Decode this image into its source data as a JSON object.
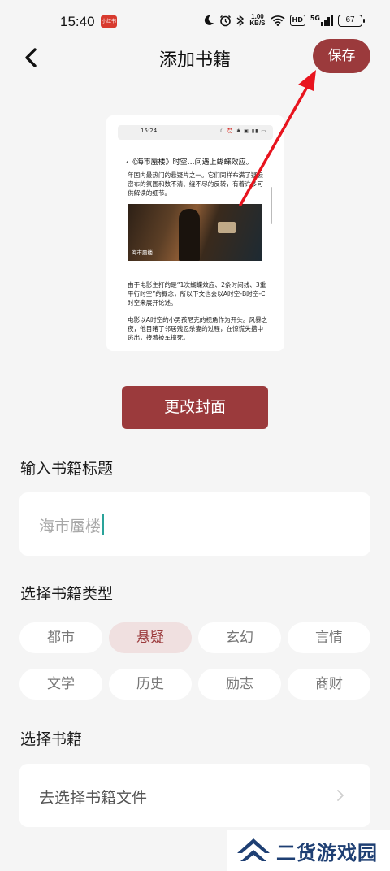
{
  "status_bar": {
    "time": "15:40",
    "app_icon_text": "小红书",
    "net_speed_value": "1.00",
    "net_speed_unit": "KB/S",
    "hd_label": "HD",
    "signal_label": "5G",
    "battery": "67"
  },
  "header": {
    "title": "添加书籍",
    "save_label": "保存"
  },
  "cover": {
    "mini_time": "15:24",
    "mini_title": "《海市蜃楼》时空…间遇上蝴蝶效应。",
    "paragraph1": "年国内最热门的悬疑片之一。它们同样布满了疑云密布的氛围和数不清、绕不尽的反转，有着许多可供解读的细节。",
    "image_caption": "海市蜃楼",
    "paragraph2": "由于电影主打的是“1次蝴蝶效应、2条时间线、3重平行时空”的概念，所以下文也会以A时空-B时空-C时空来展开论述。",
    "paragraph3": "电影以A时空的小男孩尼克的视角作为开头。风暴之夜，他目睹了邻居残忍杀妻的过程，在惊慌失措中逃出，接着被车撞死。"
  },
  "change_cover_label": "更改封面",
  "title_section": {
    "label": "输入书籍标题",
    "value": "海市蜃楼"
  },
  "type_section": {
    "label": "选择书籍类型",
    "selected": "悬疑",
    "options": [
      "都市",
      "悬疑",
      "玄幻",
      "言情",
      "文学",
      "历史",
      "励志",
      "商财"
    ]
  },
  "file_section": {
    "label": "选择书籍",
    "placeholder": "去选择书籍文件"
  },
  "watermark": {
    "text": "二货游戏园"
  },
  "colors": {
    "accent": "#9b3a3c",
    "chip_selected_bg": "#f0e0e0",
    "background": "#f5f5f5",
    "annotation_arrow": "#e8141e"
  }
}
